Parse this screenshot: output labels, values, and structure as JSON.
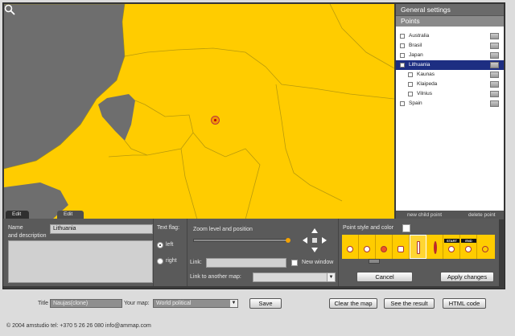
{
  "sidebar": {
    "header": "General settings",
    "subheader": "Points",
    "items": [
      {
        "label": "Australia"
      },
      {
        "label": "Brasil"
      },
      {
        "label": "Japan"
      },
      {
        "label": "Lithuania"
      },
      {
        "label": "Kaunas"
      },
      {
        "label": "Klaipeda"
      },
      {
        "label": "Vilnius"
      },
      {
        "label": "Spain"
      }
    ],
    "new_child_point": "new child point",
    "delete_point": "delete point"
  },
  "tabs": {
    "edit_lines": "Edit lines",
    "edit_points": "Edit points"
  },
  "form": {
    "name_label": "Name",
    "description_label": "and description",
    "name_value": "Lithuania",
    "text_flag_label": "Text flag:",
    "left_label": "left",
    "right_label": "right",
    "zoom_label": "Zoom level and position",
    "link_label": "Link:",
    "new_window_label": "New window",
    "link_map_label": "Link to another map:",
    "point_style_label": "Point style and color",
    "start_label": "START",
    "end_label": "END",
    "cancel_label": "Cancel",
    "apply_label": "Apply changes"
  },
  "footer": {
    "title_label": "Title",
    "title_value": "Naujas(clone)",
    "your_map_label": "Your map:",
    "your_map_value": "World political",
    "save_label": "Save",
    "clear_label": "Clear the map",
    "see_result_label": "See the result",
    "html_code_label": "HTML code",
    "copyright": "© 2004 amstudio tel: +370 5 26 26 080 info@ammap.com"
  },
  "colors": {
    "land": "#ffcc00",
    "water": "#6e6e6e",
    "selected": "#1d2e82"
  }
}
